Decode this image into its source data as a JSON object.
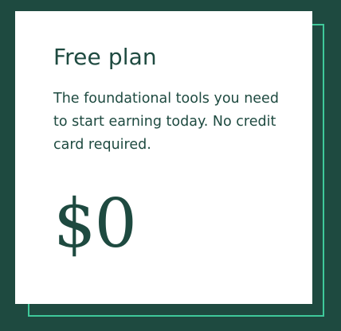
{
  "colors": {
    "background": "#1e4a40",
    "accent": "#3fc99a",
    "card": "#ffffff",
    "text": "#1e4a40"
  },
  "plan": {
    "title": "Free plan",
    "description": "The foundational tools you need to start earning today. No credit card required.",
    "price": "$0"
  }
}
